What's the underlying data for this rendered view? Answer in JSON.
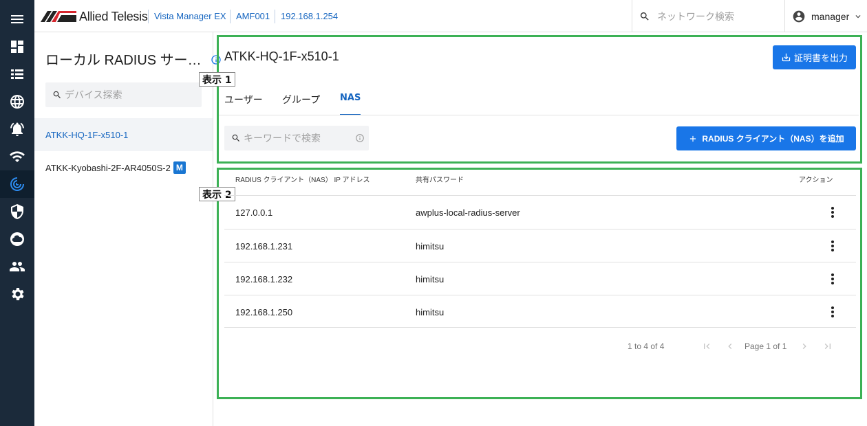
{
  "header": {
    "brand": "Allied Telesis",
    "breadcrumbs": [
      "Vista Manager EX",
      "AMF001",
      "192.168.1.254"
    ],
    "network_search_placeholder": "ネットワーク検索",
    "user": "manager"
  },
  "rail": {
    "icons": [
      "menu-icon",
      "dashboard-icon",
      "list-icon",
      "globe-icon",
      "alarm-icon",
      "wifi-icon",
      "radius-icon",
      "security-shield-icon",
      "cloud-icon",
      "users-icon",
      "settings-gear-icon"
    ],
    "active_index": 6,
    "active_color": "#2d8cf0"
  },
  "left_panel": {
    "title": "ローカル RADIUS サー…",
    "search_placeholder": "デバイス探索",
    "devices": [
      {
        "name": "ATKK-HQ-1F-x510-1",
        "badge": "",
        "selected": true
      },
      {
        "name": "ATKK-Kyobashi-2F-AR4050S-2",
        "badge": "M",
        "selected": false
      }
    ]
  },
  "callouts": {
    "view1": "表示 1",
    "view2": "表示 2"
  },
  "section1": {
    "device_title": "ATKK-HQ-1F-x510-1",
    "export_cert_label": "証明書を出力",
    "tabs": [
      {
        "label": "ユーザー",
        "active": false
      },
      {
        "label": "グループ",
        "active": false
      },
      {
        "label": "NAS",
        "active": true
      }
    ],
    "keyword_placeholder": "キーワードで検索",
    "add_client_label": "RADIUS クライアント（NAS）を追加"
  },
  "table": {
    "headers": {
      "ip": "RADIUS クライアント（NAS） IP アドレス",
      "secret": "共有パスワード",
      "action": "アクション"
    },
    "rows": [
      {
        "ip": "127.0.0.1",
        "secret": "awplus-local-radius-server"
      },
      {
        "ip": "192.168.1.231",
        "secret": "himitsu"
      },
      {
        "ip": "192.168.1.232",
        "secret": "himitsu"
      },
      {
        "ip": "192.168.1.250",
        "secret": "himitsu"
      }
    ],
    "pager": {
      "summary": "1 to 4 of 4",
      "page": "Page 1 of 1"
    }
  },
  "colors": {
    "accent": "#1976e8",
    "frame": "#3cb155",
    "rail": "#1b2a3a"
  }
}
